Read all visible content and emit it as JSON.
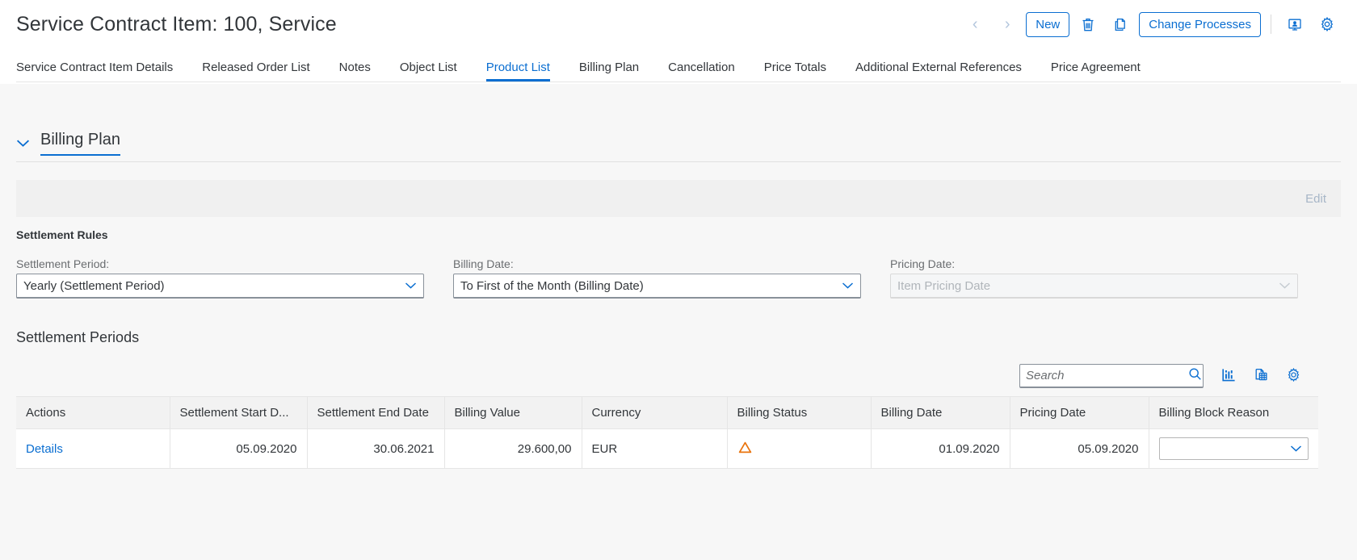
{
  "header": {
    "title": "Service Contract Item: 100, Service",
    "nav_prev": "‹",
    "nav_next": "›",
    "new_label": "New",
    "change_processes_label": "Change Processes",
    "delete_icon": "trash-icon",
    "copy_icon": "copy-icon",
    "contact_icon": "contact-screen-icon",
    "settings_icon": "gear-icon"
  },
  "tabs": [
    {
      "label": "Service Contract Item Details",
      "active": false
    },
    {
      "label": "Released Order List",
      "active": false
    },
    {
      "label": "Notes",
      "active": false
    },
    {
      "label": "Object List",
      "active": false
    },
    {
      "label": "Product List",
      "active": true
    },
    {
      "label": "Billing Plan",
      "active": false
    },
    {
      "label": "Cancellation",
      "active": false
    },
    {
      "label": "Price Totals",
      "active": false
    },
    {
      "label": "Additional External References",
      "active": false
    },
    {
      "label": "Price Agreement",
      "active": false
    }
  ],
  "billing_plan": {
    "section_title": "Billing Plan",
    "collapse_chevron": "⌄",
    "edit_label": "Edit",
    "settlement_rules_label": "Settlement Rules",
    "fields": [
      {
        "label": "Settlement Period:",
        "value": "Yearly (Settlement Period)",
        "disabled": false,
        "placeholder": ""
      },
      {
        "label": "Billing Date:",
        "value": "To First of the Month (Billing Date)",
        "disabled": false,
        "placeholder": ""
      },
      {
        "label": "Pricing Date:",
        "value": "",
        "disabled": true,
        "placeholder": "Item Pricing Date"
      }
    ]
  },
  "settlement_periods": {
    "title": "Settlement Periods",
    "search_placeholder": "Search",
    "search_value": "",
    "toolbar_icons": [
      "chart-icon",
      "spreadsheet-export-icon",
      "gear-icon"
    ],
    "columns": [
      "Actions",
      "Settlement Start D...",
      "Settlement End Date",
      "Billing Value",
      "Currency",
      "Billing Status",
      "Billing Date",
      "Pricing Date",
      "Billing Block Reason"
    ],
    "rows": [
      {
        "actions": "Details",
        "settlement_start_date": "05.09.2020",
        "settlement_end_date": "30.06.2021",
        "billing_value": "29.600,00",
        "currency": "EUR",
        "billing_status": "warning-triangle-icon",
        "billing_date": "01.09.2020",
        "pricing_date": "05.09.2020",
        "billing_block_reason": ""
      }
    ]
  },
  "colors": {
    "accent": "#0a6ed1",
    "warning": "#e9730c",
    "text": "#32363a",
    "label": "#6a6d70",
    "bg": "#f7f7f7"
  }
}
